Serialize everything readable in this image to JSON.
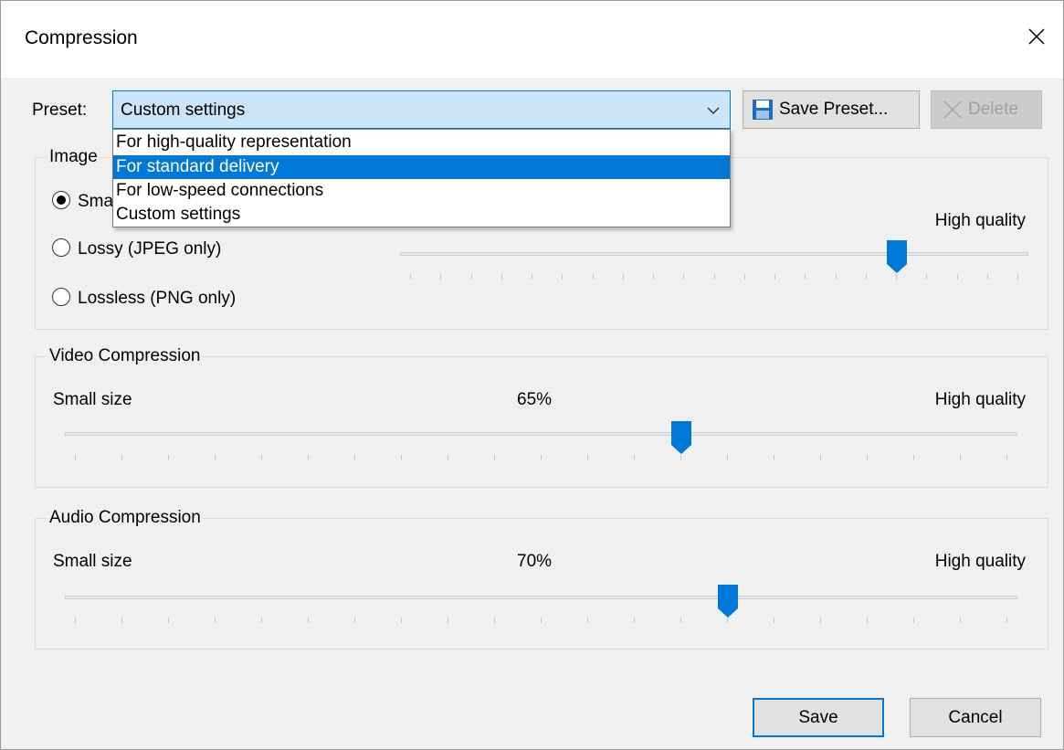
{
  "window": {
    "title": "Compression"
  },
  "preset": {
    "label": "Preset:",
    "selected": "Custom settings",
    "save_label": "Save Preset...",
    "delete_label": "Delete",
    "options": [
      "For high-quality representation",
      "For standard delivery",
      "For low-speed connections",
      "Custom settings"
    ],
    "highlighted_option": "For standard delivery"
  },
  "image": {
    "group_title": "Image",
    "radios": [
      {
        "label": "Sma",
        "checked": true
      },
      {
        "label": "Lossy (JPEG only)",
        "checked": false
      },
      {
        "label": "Lossless (PNG only)",
        "checked": false
      }
    ],
    "high_label": "High quality",
    "level": 0.8
  },
  "video": {
    "group_title": "Video Compression",
    "low_label": "Small size",
    "value_label": "65%",
    "high_label": "High quality",
    "level": 0.65
  },
  "audio": {
    "group_title": "Audio Compression",
    "low_label": "Small size",
    "value_label": "70%",
    "high_label": "High quality",
    "level": 0.7
  },
  "footer": {
    "save_label": "Save",
    "cancel_label": "Cancel"
  },
  "colors": {
    "accent": "#0078d7",
    "combo_bg": "#cce4f7",
    "dialog_bg": "#f0f0f0"
  }
}
